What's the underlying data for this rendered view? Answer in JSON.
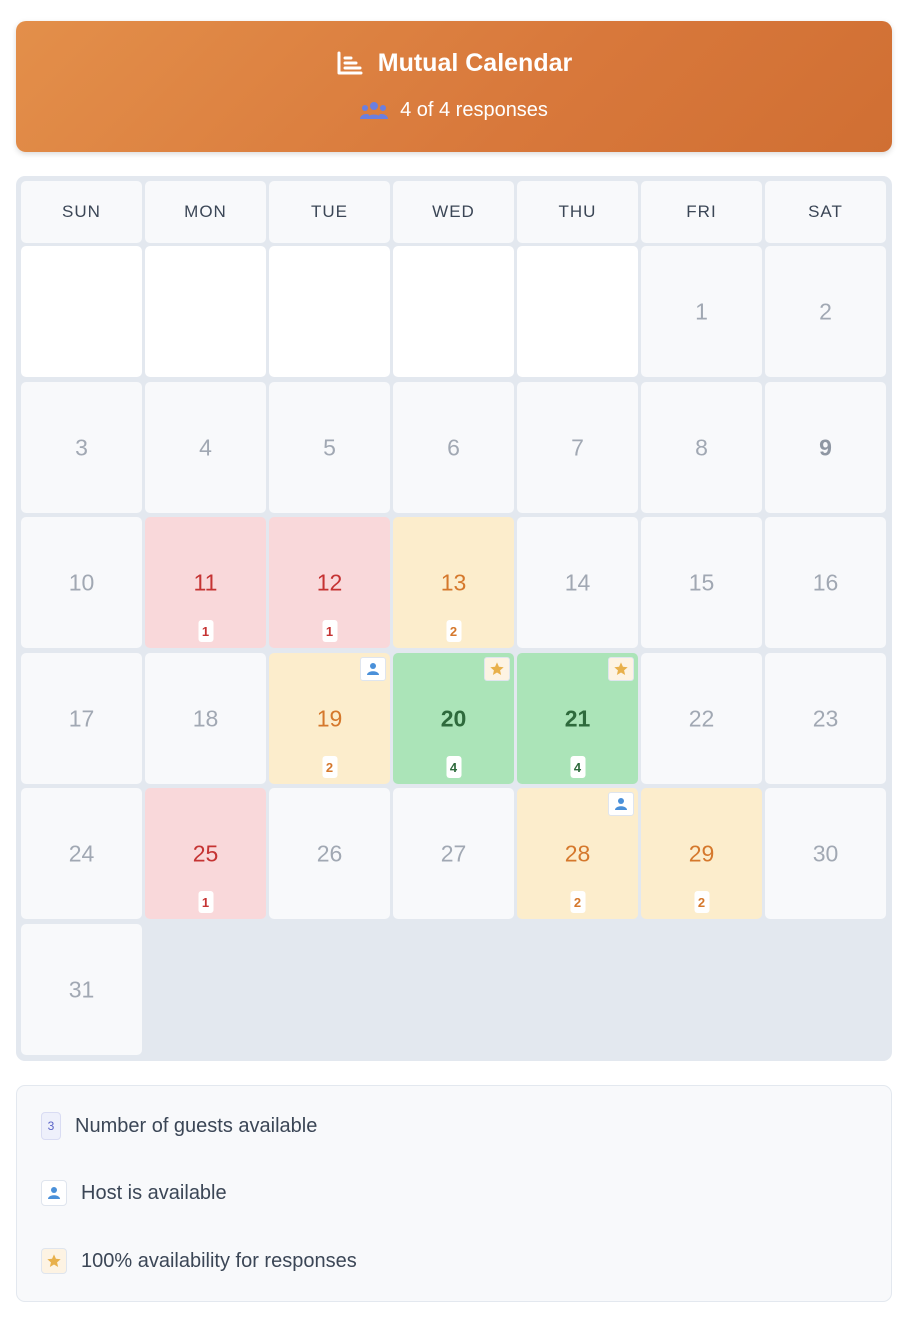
{
  "header": {
    "title": "Mutual Calendar",
    "responses": "4 of 4 responses",
    "colors": {
      "gradient_start": "#e38f4a",
      "gradient_end": "#d06f33"
    }
  },
  "calendar": {
    "weekdays": [
      "SUN",
      "MON",
      "TUE",
      "WED",
      "THU",
      "FRI",
      "SAT"
    ],
    "leading_blank_days": 5,
    "days": [
      {
        "num": "1",
        "status": "none"
      },
      {
        "num": "2",
        "status": "none"
      },
      {
        "num": "3",
        "status": "none"
      },
      {
        "num": "4",
        "status": "none"
      },
      {
        "num": "5",
        "status": "none"
      },
      {
        "num": "6",
        "status": "none"
      },
      {
        "num": "7",
        "status": "none"
      },
      {
        "num": "8",
        "status": "none"
      },
      {
        "num": "9",
        "status": "none",
        "bold": true
      },
      {
        "num": "10",
        "status": "none"
      },
      {
        "num": "11",
        "status": "red",
        "count": "1"
      },
      {
        "num": "12",
        "status": "red",
        "count": "1"
      },
      {
        "num": "13",
        "status": "orange",
        "count": "2"
      },
      {
        "num": "14",
        "status": "none"
      },
      {
        "num": "15",
        "status": "none"
      },
      {
        "num": "16",
        "status": "none"
      },
      {
        "num": "17",
        "status": "none"
      },
      {
        "num": "18",
        "status": "none"
      },
      {
        "num": "19",
        "status": "orange",
        "count": "2",
        "badge": "host"
      },
      {
        "num": "20",
        "status": "green",
        "count": "4",
        "badge": "star"
      },
      {
        "num": "21",
        "status": "green",
        "count": "4",
        "badge": "star"
      },
      {
        "num": "22",
        "status": "none"
      },
      {
        "num": "23",
        "status": "none"
      },
      {
        "num": "24",
        "status": "none"
      },
      {
        "num": "25",
        "status": "red",
        "count": "1"
      },
      {
        "num": "26",
        "status": "none"
      },
      {
        "num": "27",
        "status": "none"
      },
      {
        "num": "28",
        "status": "orange",
        "count": "2",
        "badge": "host"
      },
      {
        "num": "29",
        "status": "orange",
        "count": "2"
      },
      {
        "num": "30",
        "status": "none"
      },
      {
        "num": "31",
        "status": "none"
      }
    ],
    "colors": {
      "red": "#f9d8da",
      "orange": "#fcedcc",
      "green": "#abe4b8",
      "host_icon": "#4a90d9",
      "star_icon": "#e8b04b"
    }
  },
  "legend": {
    "count_sample": "3",
    "guests_label": "Number of guests available",
    "host_label": "Host is available",
    "star_label": "100% availability for responses"
  }
}
